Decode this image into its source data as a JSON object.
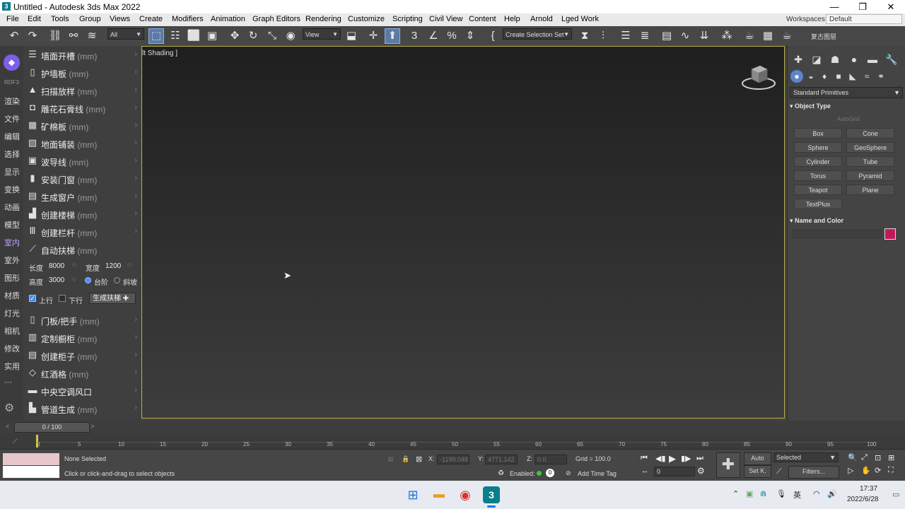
{
  "window": {
    "title": "Untitled - Autodesk 3ds Max 2022",
    "minimize": "—",
    "maximize": "❐",
    "close": "✕"
  },
  "menu": {
    "items": [
      "File",
      "Edit",
      "Tools",
      "Group",
      "Views",
      "Create",
      "Modifiers",
      "Animation",
      "Graph Editors",
      "Rendering",
      "Customize",
      "Scripting",
      "Civil View",
      "Content",
      "Help",
      "Arnold",
      "Lged Work"
    ],
    "workspaces_label": "Workspaces:",
    "workspaces_value": "Default"
  },
  "toolbar": {
    "filter_value": "All",
    "refcoord_value": "View",
    "selection_set_placeholder": "Create Selection Set",
    "right_label": "复古图层"
  },
  "left_tabs": {
    "items": [
      "RDF3",
      "渲染",
      "文件",
      "编辑",
      "选择",
      "显示",
      "变换",
      "动画",
      "模型",
      "室内",
      "室外",
      "图形",
      "材质",
      "灯光",
      "相机",
      "修改",
      "实用",
      "···"
    ],
    "selected": "室内"
  },
  "plugin_panel": {
    "unit": "(mm)",
    "items": [
      {
        "label": "墙面开槽",
        "icon": "☰"
      },
      {
        "label": "护墙板",
        "icon": "▯"
      },
      {
        "label": "扫描放样",
        "icon": "▲"
      },
      {
        "label": "雕花石膏线",
        "icon": "◘"
      },
      {
        "label": "矿棉板",
        "icon": "▦"
      },
      {
        "label": "地面铺装",
        "icon": "▨"
      },
      {
        "label": "波导线",
        "icon": "▣"
      },
      {
        "label": "安装门窗",
        "icon": "▮"
      },
      {
        "label": "生成窗户",
        "icon": "▤"
      },
      {
        "label": "创建楼梯",
        "icon": "▟"
      },
      {
        "label": "创建栏杆",
        "icon": "Ⅲ"
      },
      {
        "label": "自动扶梯",
        "icon": "⟋"
      }
    ],
    "escalator": {
      "length_label": "长度",
      "length_value": "8000",
      "width_label": "宽度",
      "width_value": "1200",
      "height_label": "高度",
      "height_value": "3000",
      "step_label": "台阶",
      "ramp_label": "斜坡",
      "up_label": "上行",
      "down_label": "下行",
      "generate_label": "生成扶梯"
    },
    "items2": [
      {
        "label": "门板/把手",
        "icon": "▯",
        "unit": "(mm)"
      },
      {
        "label": "定制橱柜",
        "icon": "▥",
        "unit": "(mm)"
      },
      {
        "label": "创建柜子",
        "icon": "▤",
        "unit": "(mm)"
      },
      {
        "label": "红酒格",
        "icon": "◇",
        "unit": "(mm)"
      },
      {
        "label": "中央空调风口",
        "icon": "▬",
        "unit": ""
      },
      {
        "label": "管道生成",
        "icon": "▙",
        "unit": "(mm)"
      }
    ]
  },
  "viewport": {
    "label": "lt Shading ]"
  },
  "command_panel": {
    "category": "Standard Primitives",
    "object_type_title": "Object Type",
    "autogrid": "AutoGrid",
    "buttons": [
      "Box",
      "Cone",
      "Sphere",
      "GeoSphere",
      "Cylinder",
      "Tube",
      "Torus",
      "Pyramid",
      "Teapot",
      "Plane",
      "TextPlus"
    ],
    "name_color_title": "Name and Color",
    "object_color": "#c2185b"
  },
  "timeline": {
    "frame": "0 / 100",
    "ticks": [
      "0",
      "5",
      "10",
      "15",
      "20",
      "25",
      "30",
      "35",
      "40",
      "45",
      "50",
      "55",
      "60",
      "65",
      "70",
      "75",
      "80",
      "85",
      "90",
      "95",
      "100"
    ]
  },
  "status": {
    "selection": "None Selected",
    "prompt": "Click or click-and-drag to select objects",
    "x_label": "X:",
    "x_value": "-1199.048",
    "y_label": "Y:",
    "y_value": "4771.142",
    "z_label": "Z:",
    "z_value": "0.0",
    "grid": "Grid = 100.0",
    "enabled_label": "Enabled:",
    "add_time_tag": "Add Time Tag",
    "auto_label": "Auto",
    "setk_label": "Set K.",
    "selected_value": "Selected",
    "filters_label": "Filters...",
    "frame_value": "0"
  },
  "taskbar": {
    "time": "17:37",
    "date": "2022/6/28",
    "ime": "英"
  }
}
